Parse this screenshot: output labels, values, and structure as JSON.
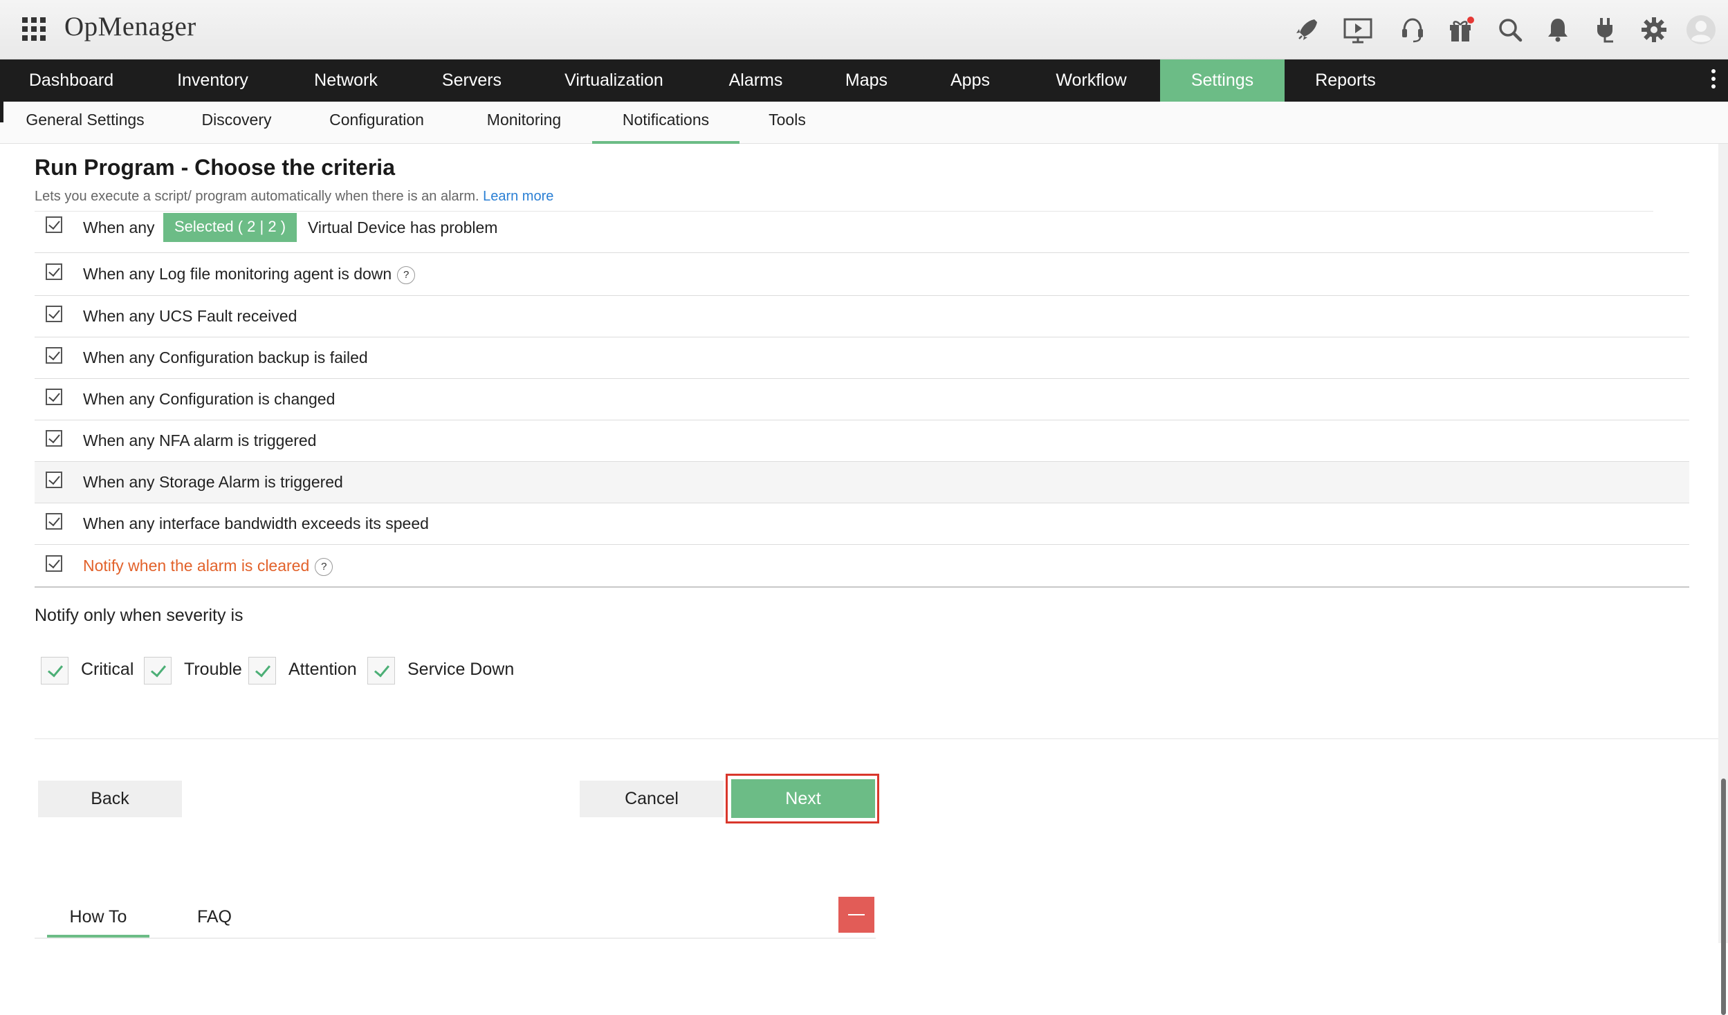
{
  "app": {
    "title": "OpMenager"
  },
  "top_icons": [
    "rocket-icon",
    "presentation-icon",
    "headset-icon",
    "gift-icon",
    "search-icon",
    "bell-icon",
    "plug-icon",
    "gear-icon",
    "user-avatar-icon"
  ],
  "main_nav": {
    "items": [
      "Dashboard",
      "Inventory",
      "Network",
      "Servers",
      "Virtualization",
      "Alarms",
      "Maps",
      "Apps",
      "Workflow",
      "Settings",
      "Reports"
    ],
    "active": "Settings"
  },
  "sub_nav": {
    "items": [
      "General Settings",
      "Discovery",
      "Configuration",
      "Monitoring",
      "Notifications",
      "Tools"
    ],
    "active": "Notifications"
  },
  "page": {
    "title": "Run Program - Choose the criteria",
    "description": "Lets you execute a script/ program automatically when there is an alarm.",
    "learn_more": "Learn more"
  },
  "criteria": {
    "row0": {
      "prefix": "When any",
      "selected_label": "Selected  ( 2 | 2 )",
      "suffix": "Virtual Device has problem",
      "checked": true
    },
    "row1": {
      "label": "When any Log file monitoring agent is down",
      "help": "?",
      "checked": true
    },
    "row2": {
      "label": "When any UCS Fault received",
      "checked": true
    },
    "row3": {
      "label": "When any Configuration backup is failed",
      "checked": true
    },
    "row4": {
      "label": "When any Configuration is changed",
      "checked": true
    },
    "row5": {
      "label": "When any NFA alarm is triggered",
      "checked": true
    },
    "row6": {
      "label": "When any Storage Alarm is triggered",
      "checked": true
    },
    "row7": {
      "label": "When any interface bandwidth exceeds its speed",
      "checked": true
    },
    "row8": {
      "label": "Notify when the alarm is cleared",
      "help": "?",
      "checked": true
    }
  },
  "severity": {
    "title": "Notify only when severity is",
    "items": [
      "Critical",
      "Trouble",
      "Attention",
      "Service Down"
    ]
  },
  "actions": {
    "back": "Back",
    "cancel": "Cancel",
    "next": "Next"
  },
  "help_tabs": {
    "items": [
      "How To",
      "FAQ"
    ],
    "active": "How To"
  },
  "colors": {
    "accent": "#6cbc86",
    "nav_bg": "#1d1d1d",
    "highlight": "#d9372c",
    "link": "#2a7fd4",
    "warning_text": "#e2622b"
  }
}
